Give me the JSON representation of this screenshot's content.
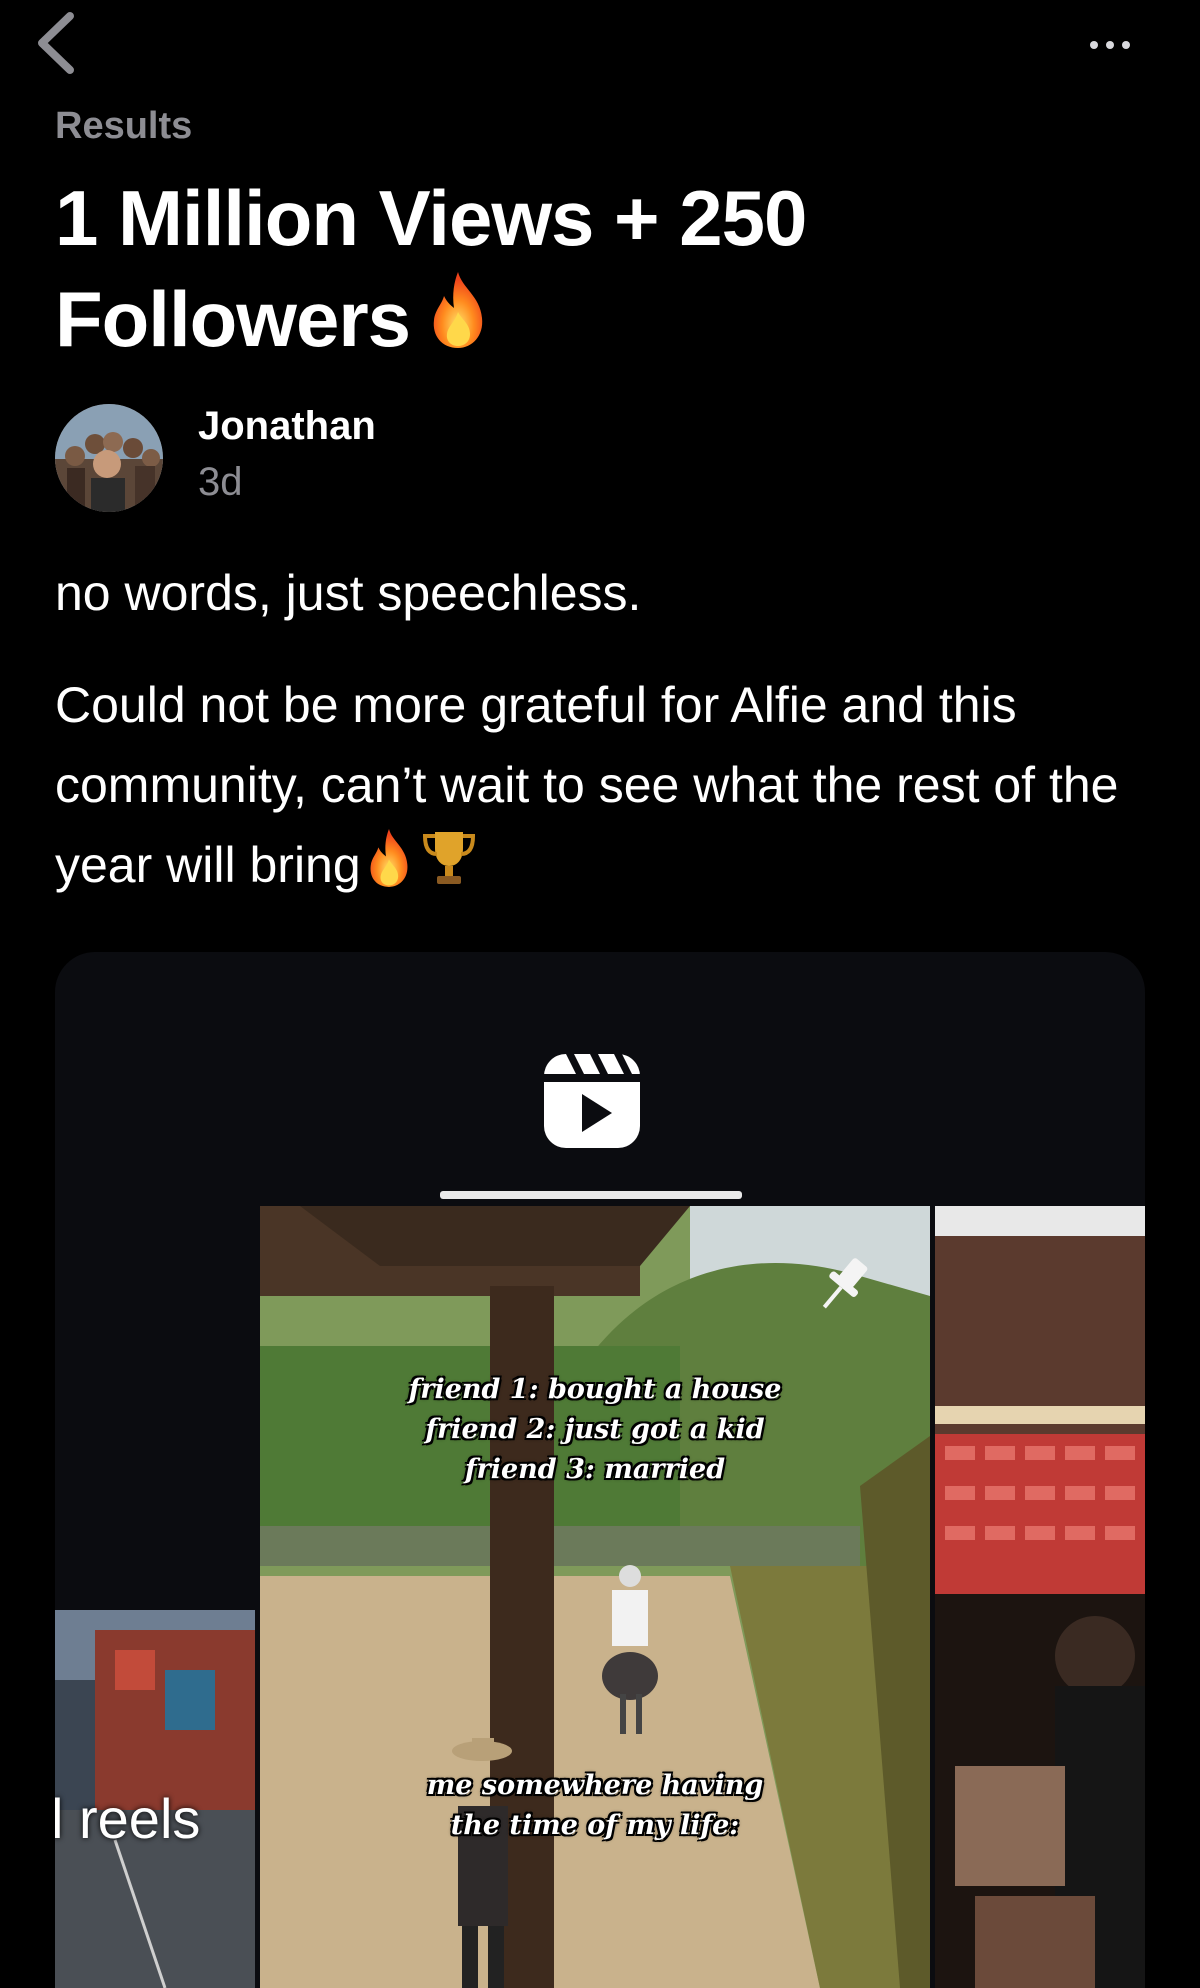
{
  "header": {
    "breadcrumb": "Results",
    "back_icon": "chevron-left-icon",
    "more_icon": "ellipsis-icon"
  },
  "post": {
    "title": "1 Million Views + 250 Followers",
    "title_emoji": "fire-icon",
    "author": {
      "name": "Jonathan",
      "age": "3d",
      "avatar": "avatar-group-photo"
    },
    "body": [
      "no words, just speechless.",
      "Could not be more grateful for Alfie and this community, can’t wait to see what the rest of the year will bring"
    ],
    "body_emojis": [
      "fire-icon",
      "trophy-icon"
    ]
  },
  "embed": {
    "logo_icon": "instagram-reels-icon",
    "progress": 1.0,
    "left_thumb_label": "l reels",
    "main_thumb": {
      "caption_top": [
        "friend 1: bought a house",
        "friend 2: just got a kid",
        "friend 3: married"
      ],
      "caption_bottom": [
        "me somewhere having",
        "the time of my life:"
      ],
      "pin_icon": "pin-icon"
    }
  },
  "colors": {
    "background": "#000000",
    "text_primary": "#ffffff",
    "text_secondary": "#8d8d93",
    "card_background": "#0b0c10"
  }
}
